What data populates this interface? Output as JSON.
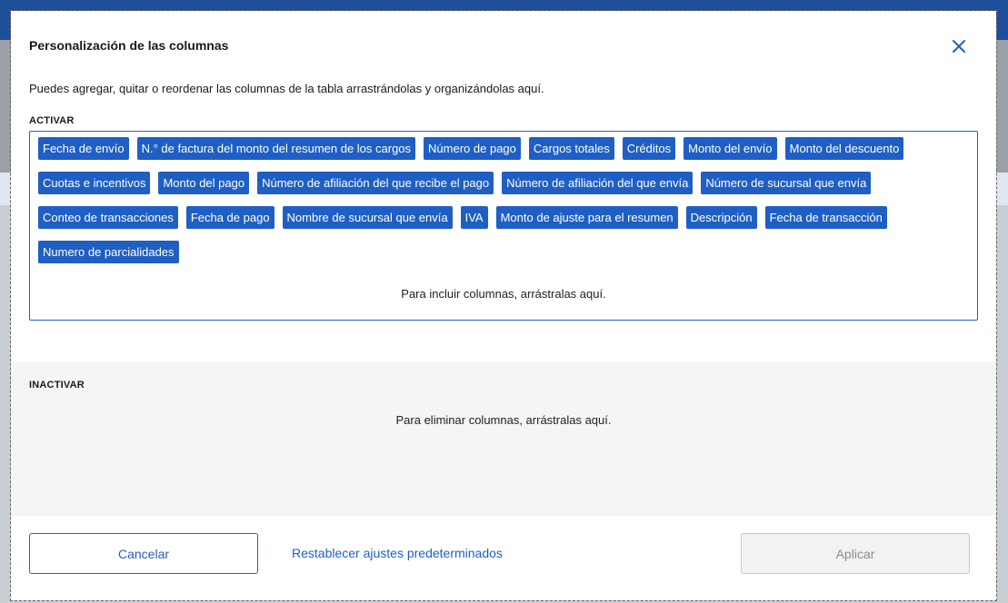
{
  "modal": {
    "title": "Personalización de las columnas",
    "description": "Puedes agregar, quitar o reordenar las columnas de la tabla arrastrándolas y organizándolas aquí.",
    "active": {
      "label": "ACTIVAR",
      "rows": [
        [
          "Fecha de envío",
          "N.° de factura del monto del resumen de los cargos",
          "Número de pago",
          "Cargos totales",
          "Créditos",
          "Monto del envío",
          "Monto del descuento"
        ],
        [
          "Cuotas e incentivos",
          "Monto del pago",
          "Número de afiliación del que recibe el pago",
          "Número de afiliación del que envía",
          "Número de sucursal que envía"
        ],
        [
          "Conteo de transacciones",
          "Fecha de pago",
          "Nombre de sucursal que envía",
          "IVA",
          "Monto de ajuste para el resumen",
          "Descripción",
          "Fecha de transacción"
        ],
        [
          "Numero de parcialidades"
        ]
      ],
      "drop_hint": "Para incluir columnas, arrástralas aquí."
    },
    "inactive": {
      "label": "INACTIVAR",
      "drop_hint": "Para eliminar columnas, arrástralas aquí."
    },
    "buttons": {
      "cancel": "Cancelar",
      "reset": "Restablecer ajustes predeterminados",
      "apply": "Aplicar"
    },
    "icons": {
      "close": "close-icon"
    },
    "colors": {
      "accent": "#1f5fc4",
      "disabled": "#f1f2f3"
    }
  }
}
